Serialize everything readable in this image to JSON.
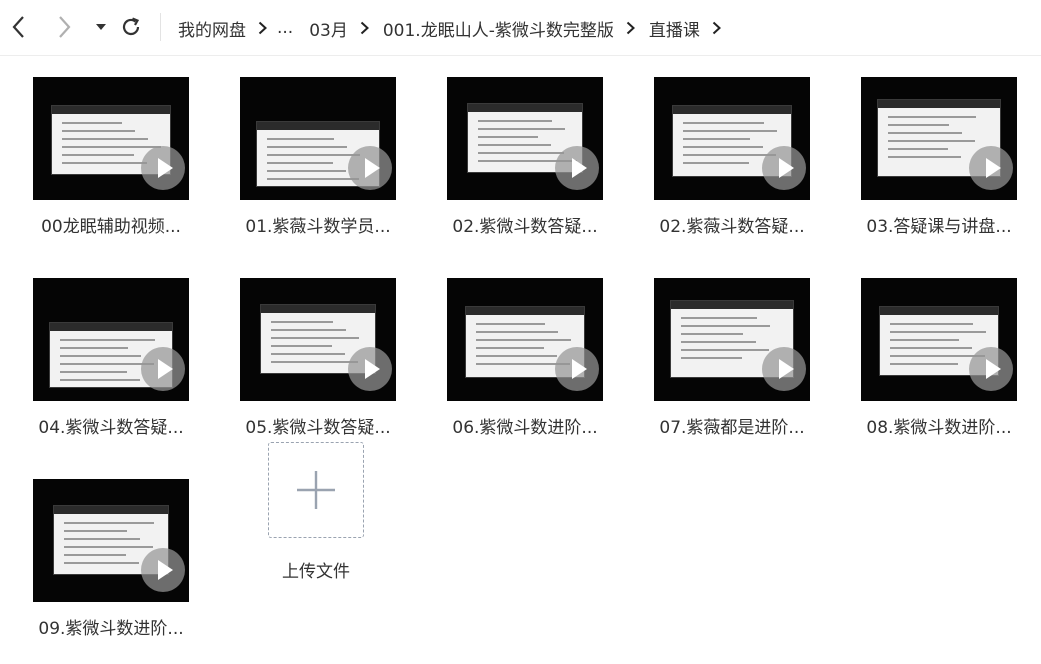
{
  "toolbar": {
    "back_icon": "chevron-left-icon",
    "forward_icon": "chevron-right-icon",
    "dropdown_icon": "caret-down-icon",
    "refresh_icon": "refresh-icon"
  },
  "breadcrumb": {
    "items": [
      "我的网盘",
      "...",
      "03月",
      "001.龙眠山人-紫微斗数完整版",
      "直播课"
    ]
  },
  "files": [
    {
      "name": "00龙眠辅助视频..."
    },
    {
      "name": "01.紫薇斗数学员..."
    },
    {
      "name": "02.紫微斗数答疑..."
    },
    {
      "name": "02.紫薇斗数答疑..."
    },
    {
      "name": "03.答疑课与讲盘..."
    },
    {
      "name": "04.紫微斗数答疑..."
    },
    {
      "name": "05.紫微斗数答疑..."
    },
    {
      "name": "06.紫微斗数进阶..."
    },
    {
      "name": "07.紫薇都是进阶..."
    },
    {
      "name": "08.紫微斗数进阶..."
    },
    {
      "name": "09.紫微斗数进阶..."
    }
  ],
  "upload": {
    "label": "上传文件",
    "icon": "plus-icon"
  },
  "colors": {
    "accent": "#9aa3b0",
    "thumb_bg": "#050505"
  }
}
